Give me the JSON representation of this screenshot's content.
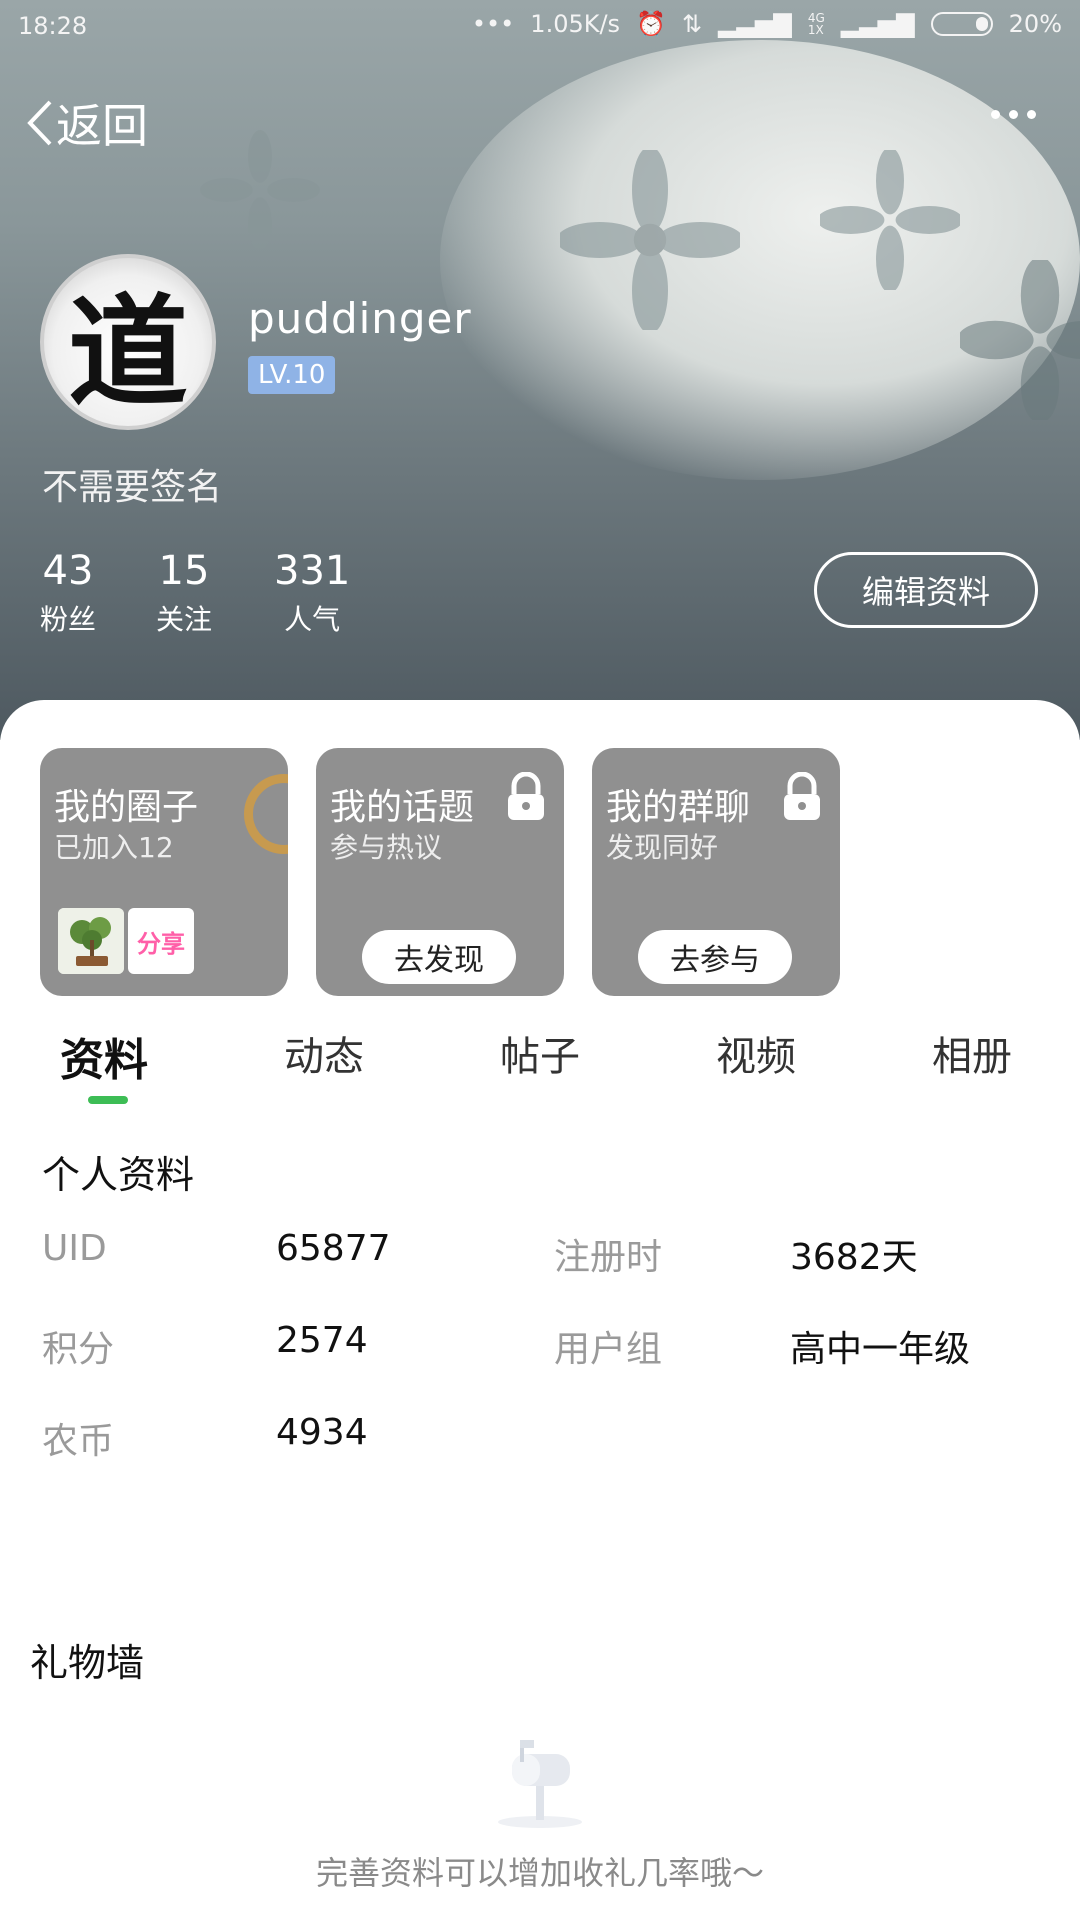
{
  "status_bar": {
    "time": "18:28",
    "network_speed": "1.05K/s",
    "battery": "20%",
    "icons": [
      "dots-icon",
      "alarm-icon",
      "data-arrows-icon",
      "signal-icon",
      "4g-icon",
      "signal-icon",
      "battery-icon"
    ]
  },
  "nav": {
    "back_label": "返回"
  },
  "profile": {
    "avatar_glyph": "道",
    "username": "puddinger",
    "level": "LV.10",
    "signature": "不需要签名",
    "stats": [
      {
        "num": "43",
        "label": "粉丝"
      },
      {
        "num": "15",
        "label": "关注"
      },
      {
        "num": "331",
        "label": "人气"
      }
    ],
    "edit_label": "编辑资料"
  },
  "cards": [
    {
      "title": "我的圈子",
      "subtitle": "已加入12",
      "thumb_label": "分享"
    },
    {
      "title": "我的话题",
      "subtitle": "参与热议",
      "button": "去发现"
    },
    {
      "title": "我的群聊",
      "subtitle": "发现同好",
      "button": "去参与"
    }
  ],
  "tabs": [
    "资料",
    "动态",
    "帖子",
    "视频",
    "相册"
  ],
  "active_tab": "资料",
  "personal_info": {
    "title": "个人资料",
    "rows": [
      {
        "label": "UID",
        "value": "65877"
      },
      {
        "label": "注册时",
        "value": "3682天"
      },
      {
        "label": "积分",
        "value": "2574"
      },
      {
        "label": "用户组",
        "value": "高中一年级"
      },
      {
        "label": "农币",
        "value": "4934"
      }
    ]
  },
  "gift_wall": {
    "title": "礼物墙",
    "hint": "完善资料可以增加收礼几率哦～"
  },
  "colors": {
    "accent": "#3dbd55",
    "level_badge": "#8fb3e6",
    "card_bg": "#909090"
  }
}
